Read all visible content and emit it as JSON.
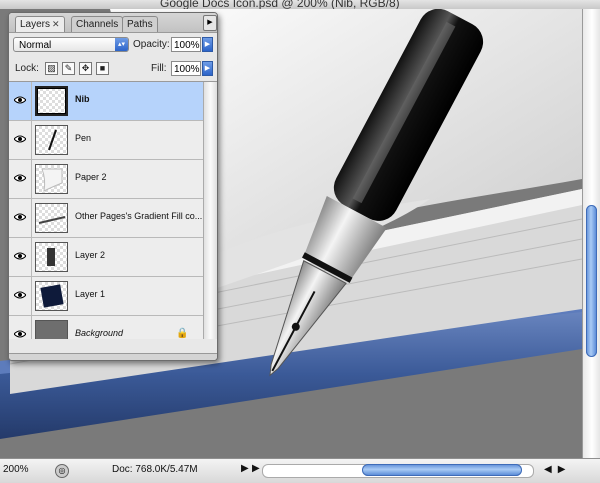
{
  "window": {
    "title": "Google Docs Icon.psd @ 200% (Nib, RGB/8)"
  },
  "layers_panel": {
    "tabs": [
      {
        "label": "Layers",
        "active": true,
        "close": "✕"
      },
      {
        "label": "Channels",
        "active": false
      },
      {
        "label": "Paths",
        "active": false
      }
    ],
    "blend_mode": "Normal",
    "opacity_label": "Opacity:",
    "opacity_value": "100%",
    "lock_label": "Lock:",
    "fill_label": "Fill:",
    "fill_value": "100%",
    "layers": [
      {
        "name": "Nib",
        "selected": true,
        "visible": true,
        "thumb": "nib"
      },
      {
        "name": "Pen",
        "selected": false,
        "visible": true,
        "thumb": "pen"
      },
      {
        "name": "Paper 2",
        "selected": false,
        "visible": true,
        "thumb": "paper"
      },
      {
        "name": "Other Pages's Gradient Fill co...",
        "selected": false,
        "visible": true,
        "thumb": "line"
      },
      {
        "name": "Layer 2",
        "selected": false,
        "visible": true,
        "thumb": "bar"
      },
      {
        "name": "Layer 1",
        "selected": false,
        "visible": true,
        "thumb": "square"
      },
      {
        "name": "Background",
        "selected": false,
        "visible": true,
        "thumb": "gray",
        "locked": true
      }
    ]
  },
  "statusbar": {
    "zoom": "200%",
    "doc_info": "Doc: 768.0K/5.47M"
  },
  "colors": {
    "accent_blue": "#5b8ad6",
    "selected_layer": "#b6d3fb",
    "book_cover": "#3a5a96"
  }
}
